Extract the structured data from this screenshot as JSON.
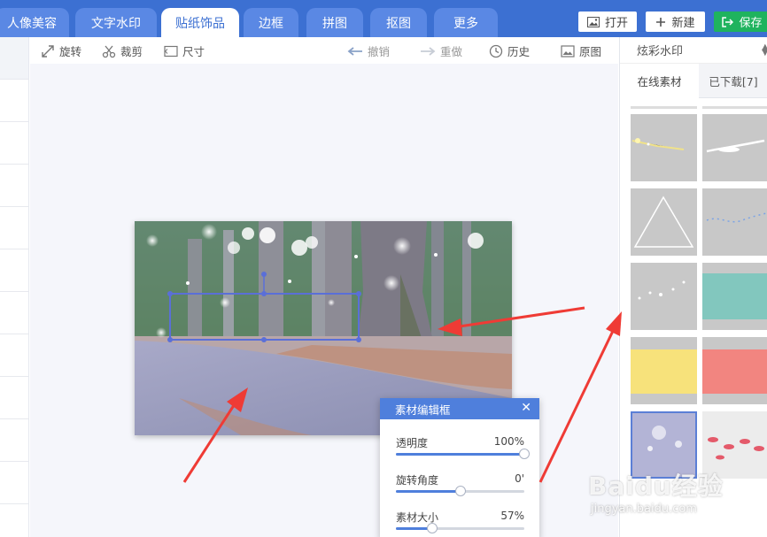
{
  "top_tabs": [
    {
      "label": "人像美容",
      "active": false
    },
    {
      "label": "文字水印",
      "active": false
    },
    {
      "label": "贴纸饰品",
      "active": true
    },
    {
      "label": "边框",
      "active": false
    },
    {
      "label": "拼图",
      "active": false
    },
    {
      "label": "抠图",
      "active": false
    },
    {
      "label": "更多",
      "active": false
    }
  ],
  "header_actions": {
    "open_label": "打开",
    "new_label": "新建",
    "save_label": "保存"
  },
  "toolbar": {
    "rotate_label": "旋转",
    "crop_label": "裁剪",
    "size_label": "尺寸",
    "undo_label": "撤销",
    "redo_label": "重做",
    "history_label": "历史",
    "original_label": "原图"
  },
  "editor_dialog": {
    "title": "素材编辑框",
    "close_icon": "close-icon",
    "sliders": [
      {
        "label": "透明度",
        "value_text": "100%",
        "level": 1.0
      },
      {
        "label": "旋转角度",
        "value_text": "0'",
        "level": 0.5
      },
      {
        "label": "素材大小",
        "value_text": "57%",
        "level": 0.28
      }
    ]
  },
  "right_panel": {
    "category": "炫彩水印",
    "tabs": [
      {
        "label": "在线素材",
        "active": true
      },
      {
        "label": "已下载[7]",
        "active": false
      }
    ],
    "thumbnails": [
      "sparkle-streak",
      "light-streak",
      "triangle-outline",
      "dotted-wave",
      "star-sparkles",
      "teal-band",
      "yellow-band",
      "red-band",
      "snow-flakes",
      "lips-pattern"
    ]
  },
  "colors": {
    "brand": "#3c70d2",
    "save_green": "#1fb35e",
    "dialog_header": "#4f7fdc",
    "arrow_red": "#ef3b35"
  },
  "watermark": {
    "main": "Baidu经验",
    "sub": "jingyan.baidu.com"
  }
}
